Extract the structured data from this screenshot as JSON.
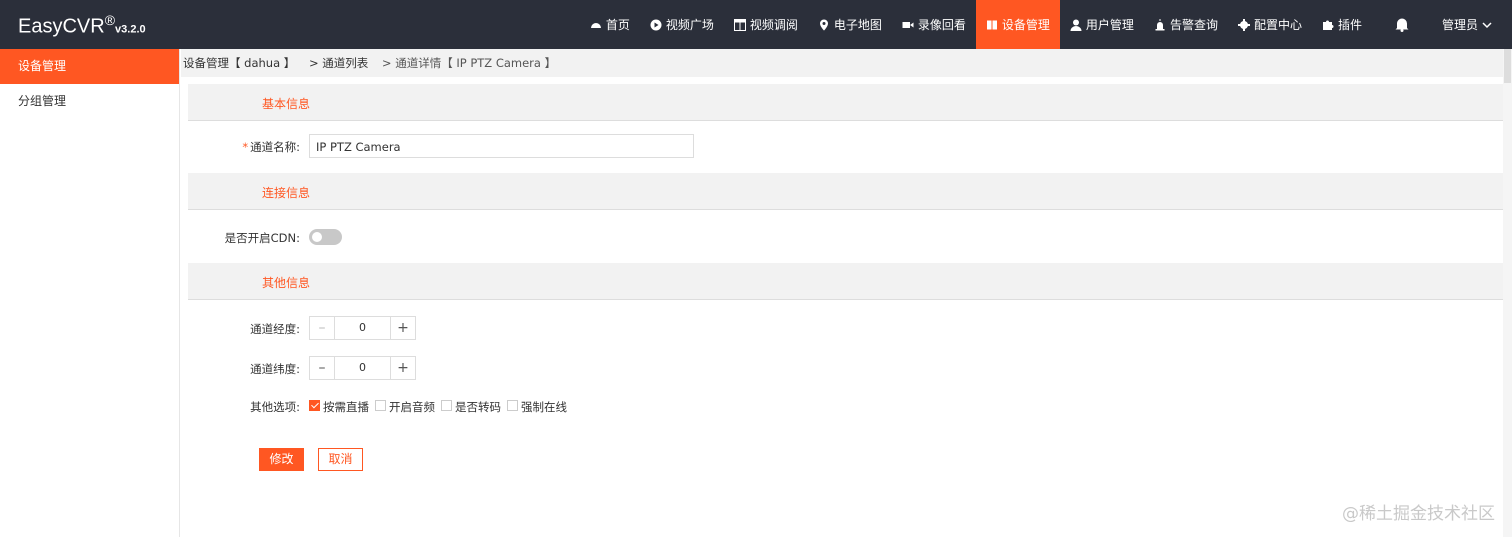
{
  "brand": {
    "name": "EasyCVR",
    "reg": "®",
    "version": "v3.2.0"
  },
  "nav": {
    "items": [
      {
        "label": "首页",
        "icon": "dashboard-icon"
      },
      {
        "label": "视频广场",
        "icon": "play-icon"
      },
      {
        "label": "视频调阅",
        "icon": "grid-icon"
      },
      {
        "label": "电子地图",
        "icon": "map-pin-icon"
      },
      {
        "label": "录像回看",
        "icon": "video-camera-icon"
      },
      {
        "label": "设备管理",
        "icon": "book-icon"
      },
      {
        "label": "用户管理",
        "icon": "user-icon"
      },
      {
        "label": "告警查询",
        "icon": "alarm-icon"
      },
      {
        "label": "配置中心",
        "icon": "gear-icon"
      },
      {
        "label": "插件",
        "icon": "puzzle-icon"
      }
    ],
    "active_label": "设备管理",
    "user": "管理员"
  },
  "sidebar": {
    "items": [
      {
        "label": "设备管理"
      },
      {
        "label": "分组管理"
      }
    ]
  },
  "breadcrumb": {
    "device": "设备管理【 dahua 】",
    "list": "> 通道列表",
    "detail": "> 通道详情【 IP PTZ Camera 】"
  },
  "sections": {
    "basic": "基本信息",
    "connection": "连接信息",
    "other": "其他信息"
  },
  "form": {
    "channel_name_required": "*",
    "channel_name_label": "通道名称:",
    "channel_name_value": "IP PTZ Camera",
    "cdn_label": "是否开启CDN:",
    "cdn_enabled": false,
    "longitude_label": "通道经度:",
    "longitude_value": "0",
    "latitude_label": "通道纬度:",
    "latitude_value": "0",
    "options_label": "其他选项:",
    "options": [
      {
        "label": "按需直播",
        "checked": true
      },
      {
        "label": "开启音频",
        "checked": false
      },
      {
        "label": "是否转码",
        "checked": false
      },
      {
        "label": "强制在线",
        "checked": false
      }
    ],
    "minus": "–",
    "plus": "+",
    "save_label": "修改",
    "cancel_label": "取消"
  },
  "watermark": "@稀土掘金技术社区",
  "colors": {
    "accent": "#ff5722",
    "topbar": "#2b2f3a"
  }
}
